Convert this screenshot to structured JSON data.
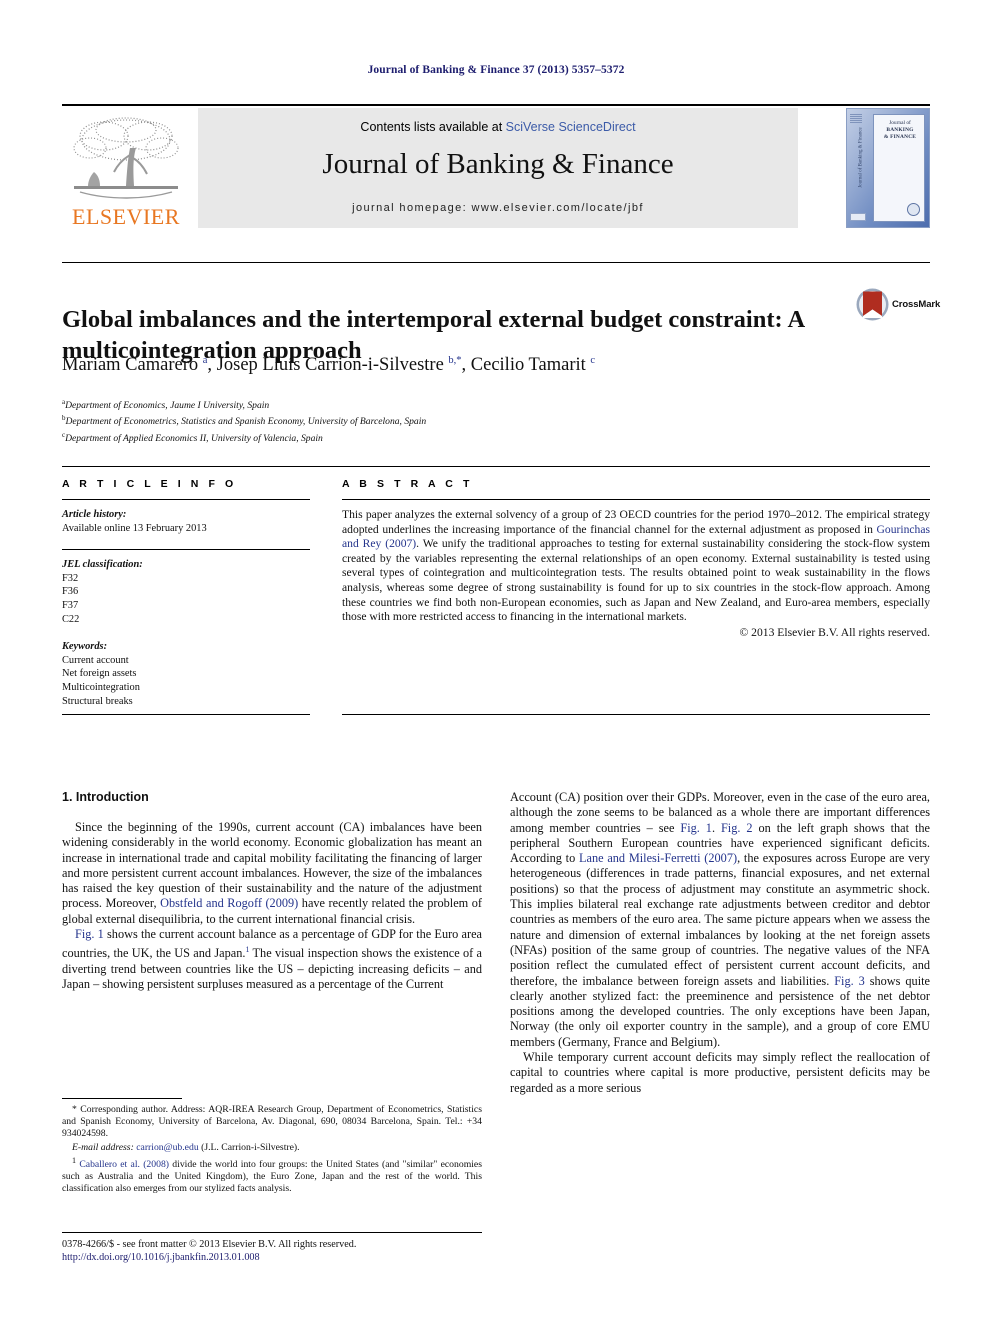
{
  "running_head": "Journal of Banking & Finance 37 (2013) 5357–5372",
  "masthead": {
    "publisher_name": "ELSEVIER",
    "contents_prefix": "Contents lists available at ",
    "contents_link": "SciVerse ScienceDirect",
    "journal_name": "Journal of Banking & Finance",
    "homepage": "journal homepage: www.elsevier.com/locate/jbf",
    "cover_line1": "Journal of",
    "cover_line2": "BANKING",
    "cover_line3": "& FINANCE",
    "cover_spine": "Journal of Banking & Finance"
  },
  "article": {
    "title": "Global imbalances and the intertemporal external budget constraint: A multicointegration approach",
    "crossmark_label": "CrossMark",
    "authors_html": "Mariam Camarero <sup>a</sup>, Josep Lluís Carrion-i-Silvestre <sup>b,*</sup>, Cecilio Tamarit <sup>c</sup>",
    "affiliations": [
      {
        "marker": "a",
        "text": "Department of Economics, Jaume I University, Spain"
      },
      {
        "marker": "b",
        "text": "Department of Econometrics, Statistics and Spanish Economy, University of Barcelona, Spain"
      },
      {
        "marker": "c",
        "text": "Department of Applied Economics II, University of Valencia, Spain"
      }
    ]
  },
  "article_info": {
    "heading": "A R T I C L E   I N F O",
    "history_label": "Article history:",
    "history_value": "Available online 13 February 2013",
    "jel_label": "JEL classification:",
    "jel_codes": [
      "F32",
      "F36",
      "F37",
      "C22"
    ],
    "keywords_label": "Keywords:",
    "keywords": [
      "Current account",
      "Net foreign assets",
      "Multicointegration",
      "Structural breaks"
    ]
  },
  "abstract": {
    "heading": "A B S T R A C T",
    "part1": "This paper analyzes the external solvency of a group of 23 OECD countries for the period 1970–2012. The empirical strategy adopted underlines the increasing importance of the financial channel for the external adjustment as proposed in ",
    "citation1": "Gourinchas and Rey (2007)",
    "part2": ". We unify the traditional approaches to testing for external sustainability considering the stock-flow system created by the variables representing the external relationships of an open economy. External sustainability is tested using several types of cointegration and multicointegration tests. The results obtained point to weak sustainability in the flows analysis, whereas some degree of strong sustainability is found for up to six countries in the stock-flow approach. Among these countries we find both non-European economies, such as Japan and New Zealand, and Euro-area members, especially those with more restricted access to financing in the international markets.",
    "copyright": "© 2013 Elsevier B.V. All rights reserved."
  },
  "body": {
    "section_heading": "1. Introduction",
    "left_p1_a": "Since the beginning of the 1990s, current account (CA) imbalances have been widening considerably in the world economy. Economic globalization has meant an increase in international trade and capital mobility facilitating the financing of larger and more persistent current account imbalances. However, the size of the imbalances has raised the key question of their sustainability and the nature of the adjustment process. Moreover, ",
    "left_p1_cite": "Obstfeld and Rogoff (2009)",
    "left_p1_b": " have recently related the problem of global external disequilibria, to the current international financial crisis.",
    "left_p2_cite": "Fig. 1",
    "left_p2_a": " shows the current account balance as a percentage of GDP for the Euro area countries, the UK, the US and Japan.",
    "left_p2_fn": "1",
    "left_p2_b": " The visual inspection shows the existence of a diverting trend between countries like the US – depicting increasing deficits – and Japan – showing persistent surpluses measured as a percentage of the Current",
    "right_p1_a": "Account (CA) position over their GDPs. Moreover, even in the case of the euro area, although the zone seems to be balanced as a whole there are important differences among member countries – see ",
    "right_p1_cite1": "Fig. 1",
    "right_p1_mid1": ". ",
    "right_p1_cite2": "Fig. 2",
    "right_p1_mid2": " on the left graph shows that the peripheral Southern European countries have experienced significant deficits. According to ",
    "right_p1_cite3": "Lane and Milesi-Ferretti (2007)",
    "right_p1_b": ", the exposures across Europe are very heterogeneous (differences in trade patterns, financial exposures, and net external positions) so that the process of adjustment may constitute an asymmetric shock. This implies bilateral real exchange rate adjustments between creditor and debtor countries as members of the euro area. The same picture appears when we assess the nature and dimension of external imbalances by looking at the net foreign assets (NFAs) position of the same group of countries. The negative values of the NFA position reflect the cumulated effect of persistent current account deficits, and therefore, the imbalance between foreign assets and liabilities. ",
    "right_p1_cite4": "Fig. 3",
    "right_p1_c": " shows quite clearly another stylized fact: the preeminence and persistence of the net debtor positions among the developed countries. The only exceptions have been Japan, Norway (the only oil exporter country in the sample), and a group of core EMU members (Germany, France and Belgium).",
    "right_p2": "While temporary current account deficits may simply reflect the reallocation of capital to countries where capital is more productive, persistent deficits may be regarded as a more serious"
  },
  "footnotes": {
    "corresponding_marker": "*",
    "corresponding": " Corresponding author. Address: AQR-IREA Research Group, Department of Econometrics, Statistics and Spanish Economy, University of Barcelona, Av. Diagonal, 690, 08034 Barcelona, Spain. Tel.: +34 934024598.",
    "email_label": "E-mail address:",
    "email": "carrion@ub.edu",
    "email_suffix": " (J.L. Carrion-i-Silvestre).",
    "fn1_marker": "1",
    "fn1_cite": "Caballero et al. (2008)",
    "fn1_text": " divide the world into four groups: the United States (and \"similar\" economies such as Australia and the United Kingdom), the Euro Zone, Japan and the rest of the world. This classification also emerges from our stylized facts analysis."
  },
  "footer": {
    "issn_line": "0378-4266/$ - see front matter © 2013 Elsevier B.V. All rights reserved.",
    "doi": "http://dx.doi.org/10.1016/j.jbankfin.2013.01.008"
  },
  "colors": {
    "link": "#24348c",
    "sciencedirect": "#3c5ba8",
    "elsevier_orange": "#e87722",
    "running_head": "#1d1d6e"
  }
}
